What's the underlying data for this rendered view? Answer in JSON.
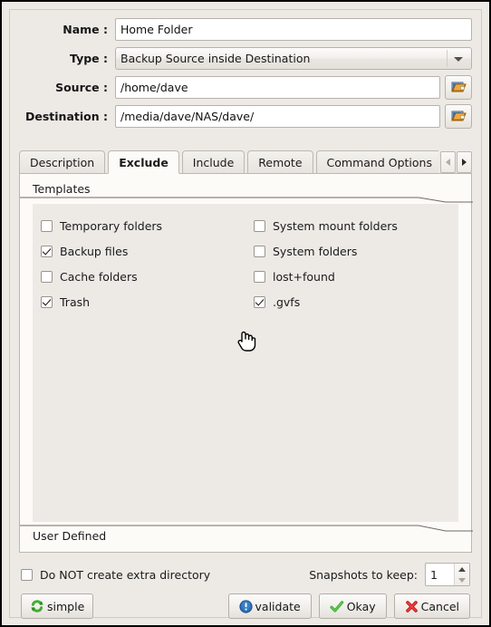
{
  "form": {
    "name": {
      "label": "Name :",
      "value": "Home Folder"
    },
    "type": {
      "label": "Type :",
      "value": "Backup Source inside Destination",
      "icon": "chevron-down-icon"
    },
    "source": {
      "label": "Source :",
      "value": "/home/dave",
      "browse_icon": "folder-open-icon"
    },
    "destination": {
      "label": "Destination :",
      "value": "/media/dave/NAS/dave/",
      "browse_icon": "folder-open-icon"
    }
  },
  "tabs": {
    "items": [
      {
        "label": "Description",
        "active": false
      },
      {
        "label": "Exclude",
        "active": true
      },
      {
        "label": "Include",
        "active": false
      },
      {
        "label": "Remote",
        "active": false
      },
      {
        "label": "Command Options",
        "active": false
      }
    ],
    "scroll_left_icon": "triangle-left-icon",
    "scroll_right_icon": "triangle-right-icon"
  },
  "exclude_page": {
    "templates_title": "Templates",
    "user_defined_title": "User Defined",
    "templates": {
      "left_column": [
        {
          "label": "Temporary folders",
          "checked": false
        },
        {
          "label": "Backup files",
          "checked": true
        },
        {
          "label": "Cache folders",
          "checked": false
        },
        {
          "label": "Trash",
          "checked": true
        }
      ],
      "right_column": [
        {
          "label": "System mount folders",
          "checked": false
        },
        {
          "label": "System folders",
          "checked": false
        },
        {
          "label": "lost+found",
          "checked": false
        },
        {
          "label": ".gvfs",
          "checked": true
        }
      ]
    }
  },
  "bottom": {
    "extra_dir": {
      "label": "Do NOT create extra directory",
      "checked": false
    },
    "snapshots": {
      "label": "Snapshots to keep:",
      "value": "1"
    },
    "buttons": {
      "simple": {
        "label": "simple",
        "icon": "recycle-icon"
      },
      "validate": {
        "label": "validate",
        "icon": "info-exclamation-icon"
      },
      "okay": {
        "label": "Okay",
        "icon": "check-icon"
      },
      "cancel": {
        "label": "Cancel",
        "icon": "x-icon"
      }
    }
  },
  "cursor": {
    "icon": "hand-pointer-cursor"
  },
  "colors": {
    "dialog_bg": "#EDEAE6",
    "page_bg": "#FDFBF8",
    "field_bg": "#FFFFFF",
    "border": "#B8B2AC",
    "accent_green": "#3FAE33",
    "accent_blue": "#2D6FB8",
    "accent_red": "#D01F1F"
  }
}
